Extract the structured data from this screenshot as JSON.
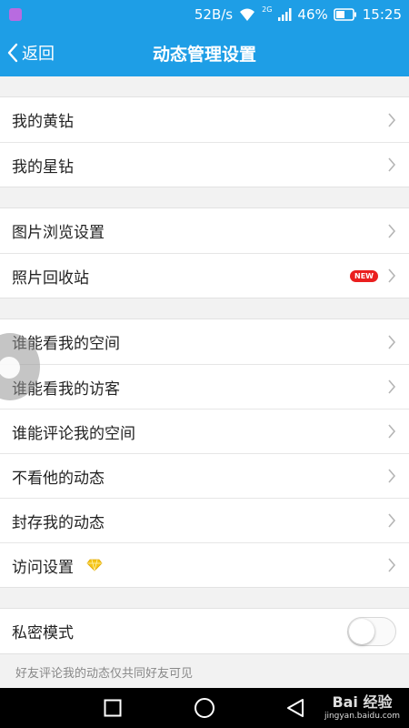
{
  "status": {
    "speed": "52B/s",
    "network": "2G",
    "battery": "46%",
    "time": "15:25"
  },
  "nav": {
    "back_label": "返回",
    "title": "动态管理设置"
  },
  "groups": [
    {
      "items": [
        {
          "label": "我的黄钻"
        },
        {
          "label": "我的星钻"
        }
      ]
    },
    {
      "items": [
        {
          "label": "图片浏览设置"
        },
        {
          "label": "照片回收站",
          "badge": "NEW"
        }
      ]
    },
    {
      "items": [
        {
          "label": "谁能看我的空间"
        },
        {
          "label": "谁能看我的访客"
        },
        {
          "label": "谁能评论我的空间"
        },
        {
          "label": "不看他的动态"
        },
        {
          "label": "封存我的动态"
        },
        {
          "label": "访问设置",
          "icon": "yellow-diamond-icon"
        }
      ]
    },
    {
      "items": [
        {
          "label": "私密模式",
          "toggle": false
        }
      ]
    }
  ],
  "private_hint": "好友评论我的动态仅共同好友可见",
  "watermark": {
    "main": "Bai 经验",
    "sub": "jingyan.baidu.com"
  },
  "colors": {
    "accent": "#1e9ee6",
    "badge": "#ea1f1f",
    "background": "#f2f2f2"
  }
}
